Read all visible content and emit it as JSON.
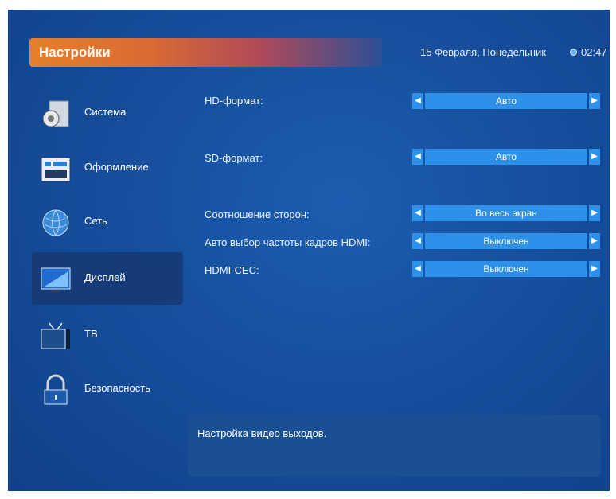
{
  "header": {
    "title": "Настройки",
    "date": "15 Февраля, Понедельник",
    "time": "02:47"
  },
  "sidebar": {
    "items": [
      {
        "label": "Система",
        "icon": "gear-box-icon"
      },
      {
        "label": "Оформление",
        "icon": "layout-icon"
      },
      {
        "label": "Сеть",
        "icon": "globe-icon"
      },
      {
        "label": "Дисплей",
        "icon": "display-icon"
      },
      {
        "label": "ТВ",
        "icon": "tv-icon"
      },
      {
        "label": "Безопасность",
        "icon": "lock-icon"
      }
    ],
    "active": "Дисплей"
  },
  "settings": [
    {
      "label": "HD-формат:",
      "value": "Авто"
    },
    {
      "label": "SD-формат:",
      "value": "Авто"
    },
    {
      "label": "Соотношение сторон:",
      "value": "Во весь экран"
    },
    {
      "label": "Авто выбор частоты кадров HDMI:",
      "value": "Выключен"
    },
    {
      "label": "HDMI-CEC:",
      "value": "Выключен"
    }
  ],
  "hint": "Настройка видео выходов.",
  "colors": {
    "background": "#164f9d",
    "selector": "#2d91ea",
    "active_item": "#153c78",
    "title_accent": "#e4802a"
  }
}
